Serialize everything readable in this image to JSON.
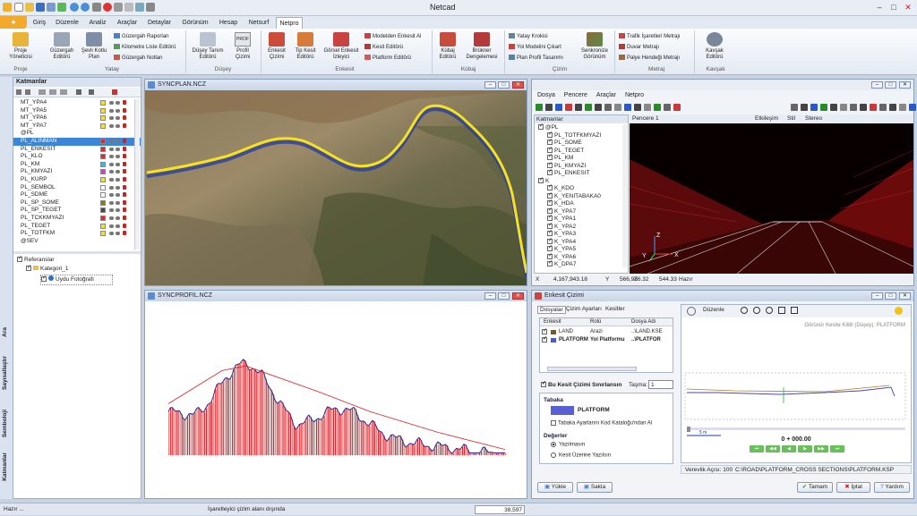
{
  "app": {
    "title": "Netcad"
  },
  "menu": {
    "tabs": [
      "Giriş",
      "Düzenle",
      "Analiz",
      "Araçlar",
      "Detaylar",
      "Görünüm",
      "Hesap",
      "Netsurf",
      "Netpro"
    ],
    "active": "Netpro"
  },
  "ribbon": {
    "groups": {
      "proje": "Proje",
      "yatay": "Yatay",
      "duey": "Düşey",
      "enkesit": "Enkesit",
      "kubaj": "Kübaj",
      "cizim": "Çizim",
      "metraj": "Metraj",
      "kavsak": "Kavşak"
    },
    "proje_yoneticisi": "Proje Yöneticisi",
    "guzergah_editoru": "Güzergah Editörü",
    "sevli_kotlu_plan": "Şevli Kotlu Plan",
    "guzergah_raporlari": "Güzergah Raporları",
    "kilometre_liste": "Kilometre Liste Editörü",
    "guzergah_notlari": "Güzergah Notları",
    "duey_tanim": "Düşey Tanım Editörü",
    "profil_cizimi": "Profil Çizimi",
    "profil_small": "PROF",
    "enkesit_cizimi": "Enkesit Çizimi",
    "tip_kesit": "Tip Kesit Editörü",
    "gorsel_enkesit": "Görsel Enkesit İzleyici",
    "modelden_enkesit": "Modelden Enkesit Al",
    "kesit_editoru": "Kesit Editörü",
    "platform_editoru": "Platform Editörü",
    "kubaj_editoru": "Kübaj Editörü",
    "bruckner": "Brükner Dengelemesi",
    "yatay_krokisi": "Yatay Krokisi",
    "yol_modeli": "Yol Modelini Çıkart",
    "plan_profil": "Plan Profil Tasarımı",
    "senkronize": "Senkronize Görünüm",
    "trafik_isaretleri": "Trafik İşaretleri Metrajı",
    "duvar_metraji": "Duvar Metrajı",
    "palye_hendegi": "Palye Hendeği Metrajı",
    "kavsak_editoru": "Kavşak Editörü"
  },
  "left_panel": {
    "title": "Katmanlar",
    "layers": [
      {
        "name": "MT_YPA4",
        "color": "#f2e21f"
      },
      {
        "name": "MT_YPA5",
        "color": "#f2e21f"
      },
      {
        "name": "MT_YPA6",
        "color": "#f2e21f"
      },
      {
        "name": "MT_YPA7",
        "color": "#f2e21f"
      },
      {
        "name": "@PL",
        "color": ""
      },
      {
        "name": "PL_ALINMAN",
        "color": "#e5262e"
      },
      {
        "name": "PL_ENKESIT",
        "color": "#e5262e"
      },
      {
        "name": "PL_KLO",
        "color": "#e5262e"
      },
      {
        "name": "PL_KM",
        "color": "#29c1e5"
      },
      {
        "name": "PL_KMYAZI",
        "color": "#d53ec5"
      },
      {
        "name": "PL_KURP",
        "color": "#f2e21f"
      },
      {
        "name": "PL_SEMBOL",
        "color": "#ffffff"
      },
      {
        "name": "PL_SDME",
        "color": "#ffffff"
      },
      {
        "name": "PL_SP_SOME",
        "color": "#8a7a1a"
      },
      {
        "name": "PL_SP_TEGET",
        "color": "#4a4a4a"
      },
      {
        "name": "PL_TCKKMYAZI",
        "color": "#e5262e"
      },
      {
        "name": "PL_TEGET",
        "color": "#f2e21f"
      },
      {
        "name": "PL_TOTFKM",
        "color": "#f2e21f"
      },
      {
        "name": "@SEV",
        "color": ""
      }
    ],
    "selected": "PL_ALINMAN",
    "refs": {
      "referanslar": "Referanslar",
      "kategori": "Kategori_1",
      "uydu": "Uydu Fotoğrafı"
    },
    "side_tabs": [
      "Ara",
      "Sayısallaştır",
      "Semboloji",
      "Katmanlar"
    ]
  },
  "windows": {
    "syncplan": "SYNCPLAN.NCZ",
    "syncprofil": "SYNCPROFIL.NCZ",
    "viewer3d": {
      "menu": [
        "Dosya",
        "Pencere",
        "Araçlar",
        "Netpro"
      ],
      "layers_title": "Katmanlar",
      "pencere": "Pencere 1",
      "toolbar_right": [
        "Etkileşim",
        "Stil",
        "Stereo"
      ],
      "tree": [
        "@PL",
        "PL_TOTFKMYAZI",
        "PL_SOME",
        "PL_TEGET",
        "PL_KM",
        "PL_KMYAZI",
        "PL_ENKESIT",
        "K",
        "K_KDO",
        "K_YENITABAKA0",
        "K_HDA",
        "K_YPA7",
        "K_YPA1",
        "K_YPA2",
        "K_YPA3",
        "K_YPA4",
        "K_YPA5",
        "K_YPA6",
        "K_DPA7"
      ],
      "coords": {
        "x_label": "X",
        "x": "4,167,943.18",
        "y_label": "Y",
        "y": "566,986.32",
        "z_label": "Z",
        "z": "544.33",
        "status": "Hazır"
      },
      "axes": {
        "x": "X",
        "y": "Y",
        "z": "Z"
      }
    },
    "enkesit": {
      "title": "Enkesit Çizimi",
      "tabs": [
        "Dosyalar",
        "Çizim Ayarları",
        "Kesitler"
      ],
      "columns": [
        "Enkesit",
        "Rolü",
        "Dosya Adı"
      ],
      "rows": [
        {
          "name": "LAND",
          "role": "Arazi",
          "file": "..\\LAND.KSE"
        },
        {
          "name": "PLATFORM",
          "role": "Yol Platformu",
          "file": "..\\PLATFOR"
        }
      ],
      "sinirla": "Bu Kesit Çizimi Sınırlansın",
      "tasma_label": "Taşma:",
      "tasma_value": "1",
      "tabaka_label": "Tabaka",
      "tabaka_value": "PLATFORM",
      "tabaka_check": "Tabaka Ayarlarını Kod Kataloğu'ndan Al",
      "degerler": "Değerler",
      "yazilmasin": "Yazılmasın",
      "kesit_uzerine": "Kesit Üzerine Yazılsın",
      "duzenle": "Düzenle",
      "kilitli": "Görünür Kesite Kilitli (Düşey): PLATFORM",
      "scale": "5 m",
      "station": "0 + 000.00",
      "verevlik": "Verevlik Açısı: 100",
      "path": "C:\\ROAD\\PLATFORM_CROSS SECTIONS\\PLATFORM.KSP",
      "buttons": {
        "yukle": "Yükle",
        "sakla": "Sakla",
        "tamam": "Tamam",
        "iptal": "İptal",
        "yardim": "Yardım"
      }
    }
  },
  "status": {
    "left": "Hazır ...",
    "middle": "İşaretleyici çizim alanı dışında",
    "value": "38,597"
  }
}
